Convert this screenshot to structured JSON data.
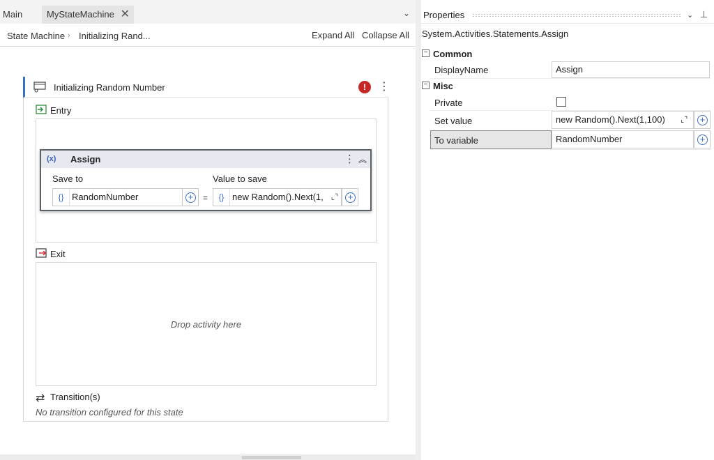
{
  "tabs": {
    "main": "Main",
    "state_machine": "MyStateMachine",
    "close_glyph": "✕",
    "dropdown_glyph": "⌄"
  },
  "breadcrumb": {
    "root": "State Machine",
    "separator": "›",
    "current": "Initializing Rand..."
  },
  "toolbar": {
    "expand_all": "Expand All",
    "collapse_all": "Collapse All"
  },
  "state": {
    "title": "Initializing Random Number",
    "error_glyph": "!",
    "menu_glyph": "⋮",
    "entry_label": "Entry",
    "exit_label": "Exit",
    "drop_hint": "Drop activity here",
    "transitions_label": "Transition(s)",
    "transitions_glyph": "⇄",
    "no_transition": "No transition configured for this state"
  },
  "assign": {
    "icon_text": "(x)",
    "title": "Assign",
    "menu_glyph": "⋮",
    "collapse_glyph": "︽",
    "save_to_label": "Save to",
    "value_to_save_label": "Value to save",
    "save_to_value": "RandomNumber",
    "value_to_save_value": "new Random().Next(1,",
    "brace_glyph": "{}",
    "equals": "=",
    "plus_glyph": "+",
    "expand_glyph": "⌞⌝"
  },
  "properties": {
    "title": "Properties",
    "dropdown_glyph": "⌄",
    "pin_glyph": "⊥",
    "type_name": "System.Activities.Statements.Assign",
    "categories": {
      "common": "Common",
      "misc": "Misc",
      "toggle_glyph": "−"
    },
    "rows": {
      "display_name_label": "DisplayName",
      "display_name_value": "Assign",
      "private_label": "Private",
      "set_value_label": "Set value",
      "set_value_value": "new Random().Next(1,100)",
      "to_variable_label": "To variable",
      "to_variable_value": "RandomNumber"
    },
    "private_checked": false
  },
  "colors": {
    "accent": "#3b6fc8",
    "error": "#c62828",
    "entry_icon": "#2e8b3a",
    "exit_icon": "#d32f2f"
  }
}
